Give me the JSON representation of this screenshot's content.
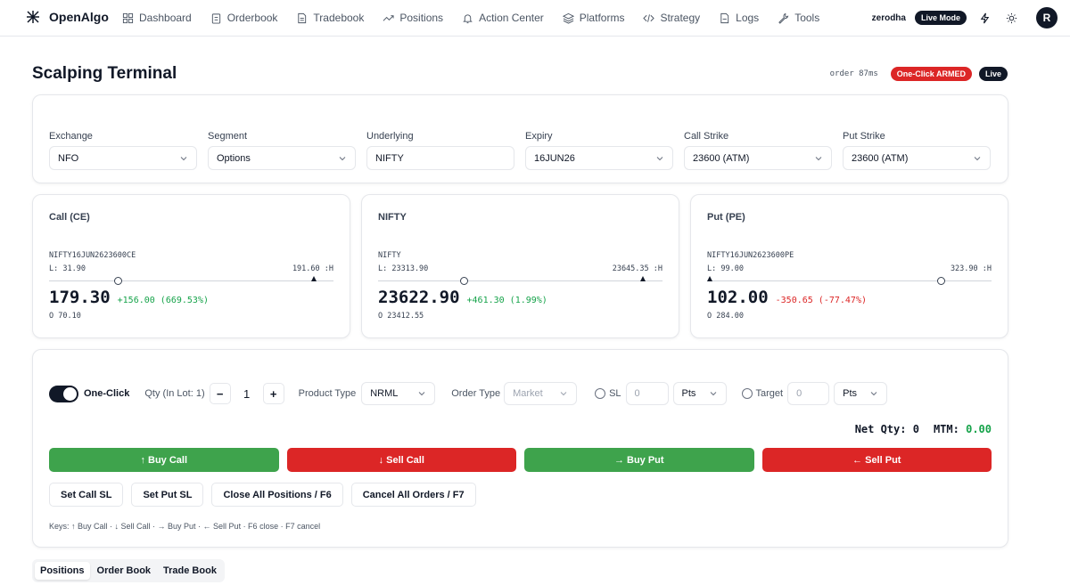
{
  "app": {
    "name": "OpenAlgo"
  },
  "nav": {
    "items": [
      {
        "label": "Dashboard",
        "icon": "grid-icon"
      },
      {
        "label": "Orderbook",
        "icon": "clipboard-icon"
      },
      {
        "label": "Tradebook",
        "icon": "file-text-icon"
      },
      {
        "label": "Positions",
        "icon": "trending-up-icon"
      },
      {
        "label": "Action Center",
        "icon": "bell-icon"
      },
      {
        "label": "Platforms",
        "icon": "layers-icon"
      },
      {
        "label": "Strategy",
        "icon": "code-icon"
      },
      {
        "label": "Logs",
        "icon": "file-icon"
      },
      {
        "label": "Tools",
        "icon": "wrench-icon"
      }
    ],
    "broker": "zerodha",
    "mode_badge": "Live Mode",
    "avatar_initial": "R"
  },
  "header": {
    "title": "Scalping Terminal",
    "latency": "order 87ms",
    "armed_badge": "One-Click ARMED",
    "live_badge": "Live"
  },
  "selectors": {
    "exchange": {
      "label": "Exchange",
      "value": "NFO"
    },
    "segment": {
      "label": "Segment",
      "value": "Options"
    },
    "underlying": {
      "label": "Underlying",
      "value": "NIFTY"
    },
    "expiry": {
      "label": "Expiry",
      "value": "16JUN26"
    },
    "call_strike": {
      "label": "Call Strike",
      "value": "23600 (ATM)"
    },
    "put_strike": {
      "label": "Put Strike",
      "value": "23600 (ATM)"
    }
  },
  "quotes": {
    "call": {
      "title": "Call (CE)",
      "symbol": "NIFTY16JUN2623600CE",
      "low": "L: 31.90",
      "high": "191.60 :H",
      "price": "179.30",
      "change": "+156.00 (669.53%)",
      "open": "O 70.10",
      "ltp_pos": 0.24,
      "open_pos": 0.93
    },
    "index": {
      "title": "NIFTY",
      "symbol": "NIFTY",
      "low": "L: 23313.90",
      "high": "23645.35 :H",
      "price": "23622.90",
      "change": "+461.30 (1.99%)",
      "open": "O 23412.55",
      "ltp_pos": 0.3,
      "open_pos": 0.93
    },
    "put": {
      "title": "Put (PE)",
      "symbol": "NIFTY16JUN2623600PE",
      "low": "L: 99.00",
      "high": "323.90 :H",
      "price": "102.00",
      "change": "-350.65 (-77.47%)",
      "open": "O 284.00",
      "ltp_pos": 0.82,
      "open_pos": 0.01
    }
  },
  "order": {
    "one_click_label": "One-Click",
    "qty_label": "Qty (In Lot: 1)",
    "qty_minus": "−",
    "qty_value": "1",
    "qty_plus": "+",
    "product_label": "Product Type",
    "product_value": "NRML",
    "order_type_label": "Order Type",
    "order_type_value": "Market",
    "sl_label": "SL",
    "sl_value": "0",
    "sl_unit": "Pts",
    "target_label": "Target",
    "target_value": "0",
    "target_unit": "Pts",
    "net_qty_label": "Net Qty:",
    "net_qty_value": "0",
    "mtm_label": "MTM:",
    "mtm_value": "0.00",
    "buy_call": "↑ Buy Call",
    "sell_call": "↓ Sell Call",
    "buy_put": "→ Buy Put",
    "sell_put": "← Sell Put",
    "set_call_sl": "Set Call SL",
    "set_put_sl": "Set Put SL",
    "close_all": "Close All Positions / F6",
    "cancel_all": "Cancel All Orders / F7",
    "keys_hint": "Keys: ↑ Buy Call · ↓ Sell Call · → Buy Put · ← Sell Put · F6 close · F7 cancel"
  },
  "bottom_tabs": [
    "Positions",
    "Order Book",
    "Trade Book"
  ],
  "colors": {
    "buy": "#3ea34c",
    "sell": "#dc2626",
    "dark": "#111827"
  }
}
